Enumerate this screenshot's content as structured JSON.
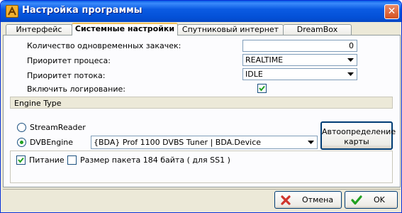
{
  "window": {
    "title": "Настройка программы"
  },
  "tabs": [
    {
      "label": "Интерфейс"
    },
    {
      "label": "Системные настройки",
      "active": true
    },
    {
      "label": "Спутниковый интернет"
    },
    {
      "label": "DreamBox"
    }
  ],
  "settings": {
    "concurrent_downloads_label": "Количество одновременных закачек:",
    "concurrent_downloads_value": "0",
    "process_priority_label": "Приоритет процеса:",
    "process_priority_value": "REALTIME",
    "thread_priority_label": "Приоритет потока:",
    "thread_priority_value": "IDLE",
    "logging_label": "Включить логирование:",
    "logging_checked": true
  },
  "engine": {
    "section_title": "Engine Type",
    "streamreader_label": "StreamReader",
    "dvbengine_label": "DVBEngine",
    "selected": "DVBEngine",
    "device_value": "{BDA} Prof 1100 DVBS Tuner | BDA.Device",
    "autodetect_line1": "Автоопределение",
    "autodetect_line2": "карты"
  },
  "power": {
    "power_label": "Питание",
    "power_checked": true,
    "packet_label": "Размер пакета 184 байта ( для SS1 )",
    "packet_checked": false
  },
  "footer": {
    "cancel_label": "Отмена",
    "ok_label": "OK"
  },
  "colors": {
    "title_bar": "#0a5ee6",
    "active_tab_accent": "#f1c05a",
    "check_green": "#21a121",
    "cancel_icon_red": "#d0342c"
  }
}
